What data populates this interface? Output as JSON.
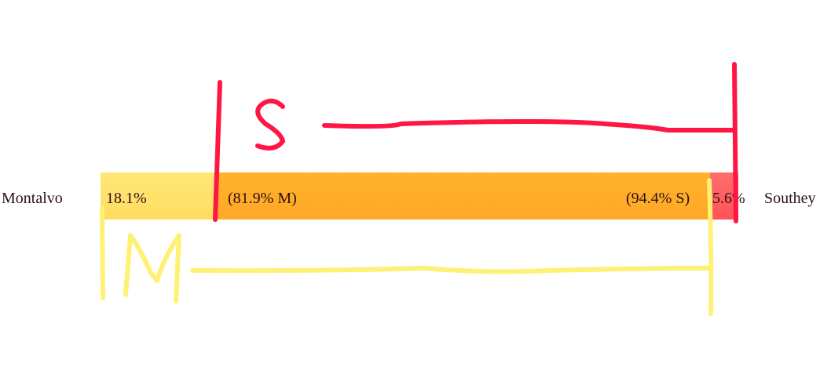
{
  "left_name": "Montalvo",
  "right_name": "Southey",
  "segments": {
    "left_only": "18.1%",
    "middle_left": "(81.9% M)",
    "middle_right": "(94.4% S)",
    "right_only": "5.6%"
  },
  "annotations": {
    "top_letter": "S",
    "bottom_letter": "M"
  },
  "colors": {
    "left_only": "#ffe06b",
    "overlap": "#ffad28",
    "right_only": "#ff5a5f",
    "annotation_top": "#ff1744",
    "annotation_bottom": "#fff176"
  }
}
